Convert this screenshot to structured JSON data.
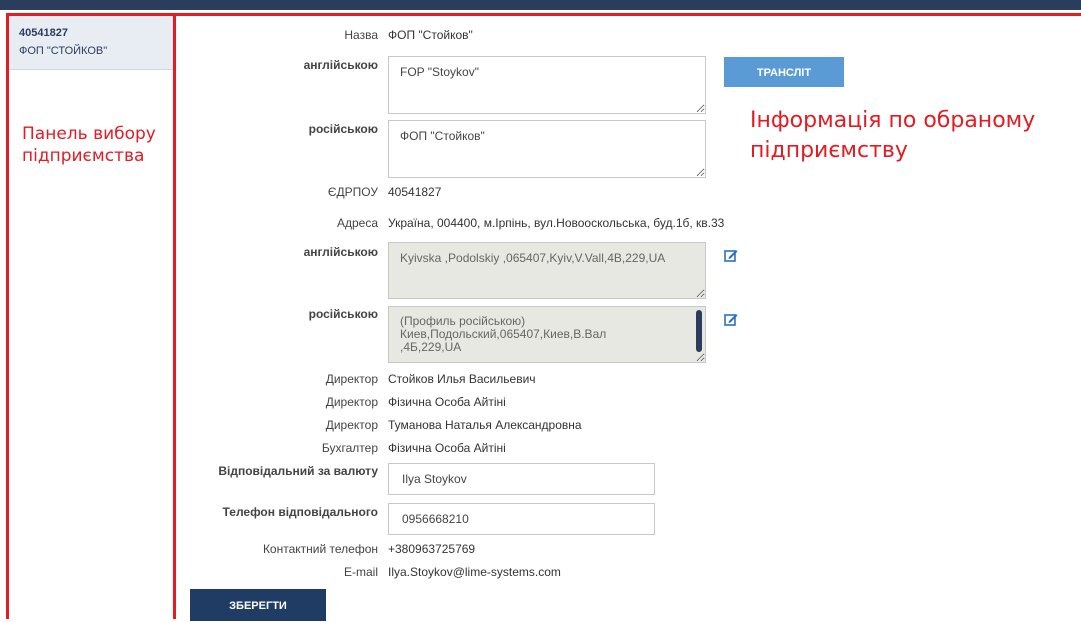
{
  "sidebar": {
    "company": {
      "code": "40541827",
      "name": "ФОП \"СТОЙКОВ\""
    },
    "annotation": "Панель вибору підприємства"
  },
  "annotation_main": "Інформація по обраному підприємству",
  "form": {
    "name": {
      "label": "Назва",
      "value": "ФОП \"Стойков\""
    },
    "name_en": {
      "label": "англійською",
      "value": "FOP \"Stoykov\""
    },
    "translit_button": "ТРАНСЛІТ",
    "name_ru": {
      "label": "російською",
      "value": "ФОП \"Стойков\""
    },
    "edrpou": {
      "label": "ЄДРПОУ",
      "value": "40541827"
    },
    "address": {
      "label": "Адреса",
      "value": "Україна, 004400, м.Ірпінь, вул.Новооскольська, буд.1б, кв.33"
    },
    "address_en": {
      "label": "англійською",
      "value": "Kyivska ,Podolskiy ,065407,Kyiv,V.Vall,4B,229,UA"
    },
    "address_ru": {
      "label": "російською",
      "value": "(Профиль російською)\nКиев,Подольский,065407,Киев,В.Вал\n,4Б,229,UA"
    },
    "people": [
      {
        "label": "Директор",
        "value": "Стойков Илья Васильевич"
      },
      {
        "label": "Директор",
        "value": "Фізична Особа Айтіні"
      },
      {
        "label": "Директор",
        "value": "Туманова Наталья Александровна"
      },
      {
        "label": "Бухгалтер",
        "value": "Фізична Особа Айтіні"
      }
    ],
    "currency_responsible": {
      "label": "Відповідальний за валюту",
      "value": "Ilya Stoykov"
    },
    "responsible_phone": {
      "label": "Телефон відповідального",
      "value": "0956668210"
    },
    "contact_phone": {
      "label": "Контактний телефон",
      "value": "+380963725769"
    },
    "email": {
      "label": "E-mail",
      "value": "Ilya.Stoykov@lime-systems.com"
    },
    "save_button": "ЗБЕРЕГТИ"
  },
  "icons": {
    "edit": "edit-icon"
  },
  "colors": {
    "accent_red": "#e41b23",
    "header": "#2b3d5c",
    "translit": "#5b9bd5",
    "save": "#1f3d64"
  }
}
